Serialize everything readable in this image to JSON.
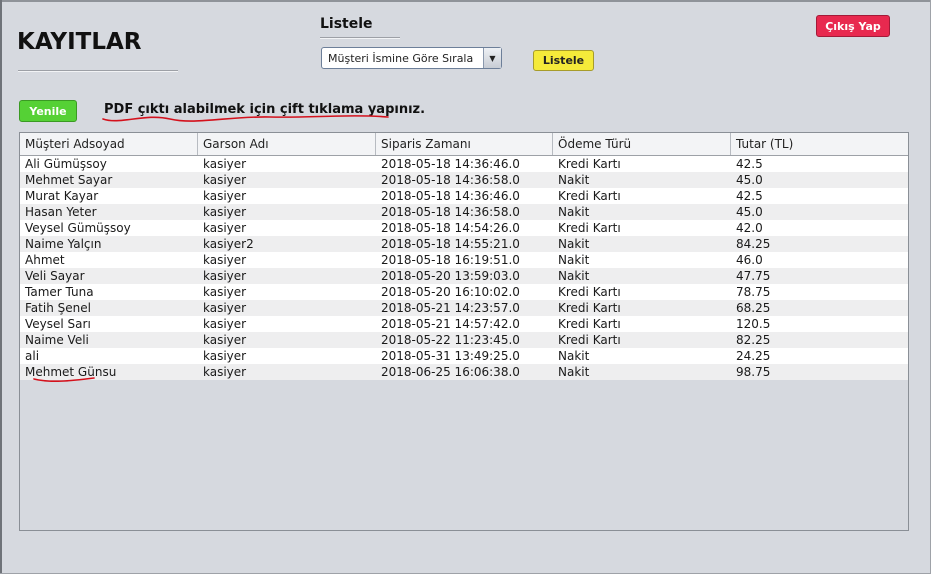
{
  "page": {
    "title": "KAYITLAR"
  },
  "list_section": {
    "label": "Listele",
    "sort_select_value": "Müşteri İsmine Göre Sırala",
    "list_button": "Listele"
  },
  "header_actions": {
    "exit_button": "Çıkış Yap"
  },
  "toolbar": {
    "refresh_button": "Yenile",
    "pdf_hint": "PDF çıktı alabilmek için çift tıklama yapınız."
  },
  "colors": {
    "exit_button": "#e8294f",
    "list_button": "#f5ea3a",
    "refresh_button": "#55d135",
    "annotation": "#d4111c"
  },
  "icons": {
    "select_arrow": "chevron-down-icon"
  },
  "table": {
    "columns": [
      "Müşteri Adsoyad",
      "Garson Adı",
      "Siparis Zamanı",
      "Ödeme Türü",
      "Tutar (TL)"
    ],
    "rows": [
      [
        "Ali Gümüşsoy",
        "kasiyer",
        "2018-05-18 14:36:46.0",
        "Kredi Kartı",
        "42.5"
      ],
      [
        "Mehmet Sayar",
        "kasiyer",
        "2018-05-18 14:36:58.0",
        "Nakit",
        "45.0"
      ],
      [
        "Murat Kayar",
        "kasiyer",
        "2018-05-18 14:36:46.0",
        "Kredi Kartı",
        "42.5"
      ],
      [
        "Hasan Yeter",
        "kasiyer",
        "2018-05-18 14:36:58.0",
        "Nakit",
        "45.0"
      ],
      [
        "Veysel Gümüşsoy",
        "kasiyer",
        "2018-05-18 14:54:26.0",
        "Kredi Kartı",
        "42.0"
      ],
      [
        "Naime Yalçın",
        "kasiyer2",
        "2018-05-18 14:55:21.0",
        "Nakit",
        "84.25"
      ],
      [
        "Ahmet",
        "kasiyer",
        "2018-05-18 16:19:51.0",
        "Nakit",
        "46.0"
      ],
      [
        "Veli Sayar",
        "kasiyer",
        "2018-05-20 13:59:03.0",
        "Nakit",
        "47.75"
      ],
      [
        "Tamer Tuna",
        "kasiyer",
        "2018-05-20 16:10:02.0",
        "Kredi Kartı",
        "78.75"
      ],
      [
        "Fatih Şenel",
        "kasiyer",
        "2018-05-21 14:23:57.0",
        "Kredi Kartı",
        "68.25"
      ],
      [
        "Veysel Sarı",
        "kasiyer",
        "2018-05-21 14:57:42.0",
        "Kredi Kartı",
        "120.5"
      ],
      [
        "Naime Veli",
        "kasiyer",
        "2018-05-22 11:23:45.0",
        "Kredi Kartı",
        "82.25"
      ],
      [
        "ali",
        "kasiyer",
        "2018-05-31 13:49:25.0",
        "Nakit",
        "24.25"
      ],
      [
        "Mehmet Günsu",
        "kasiyer",
        "2018-06-25 16:06:38.0",
        "Nakit",
        "98.75"
      ]
    ]
  }
}
